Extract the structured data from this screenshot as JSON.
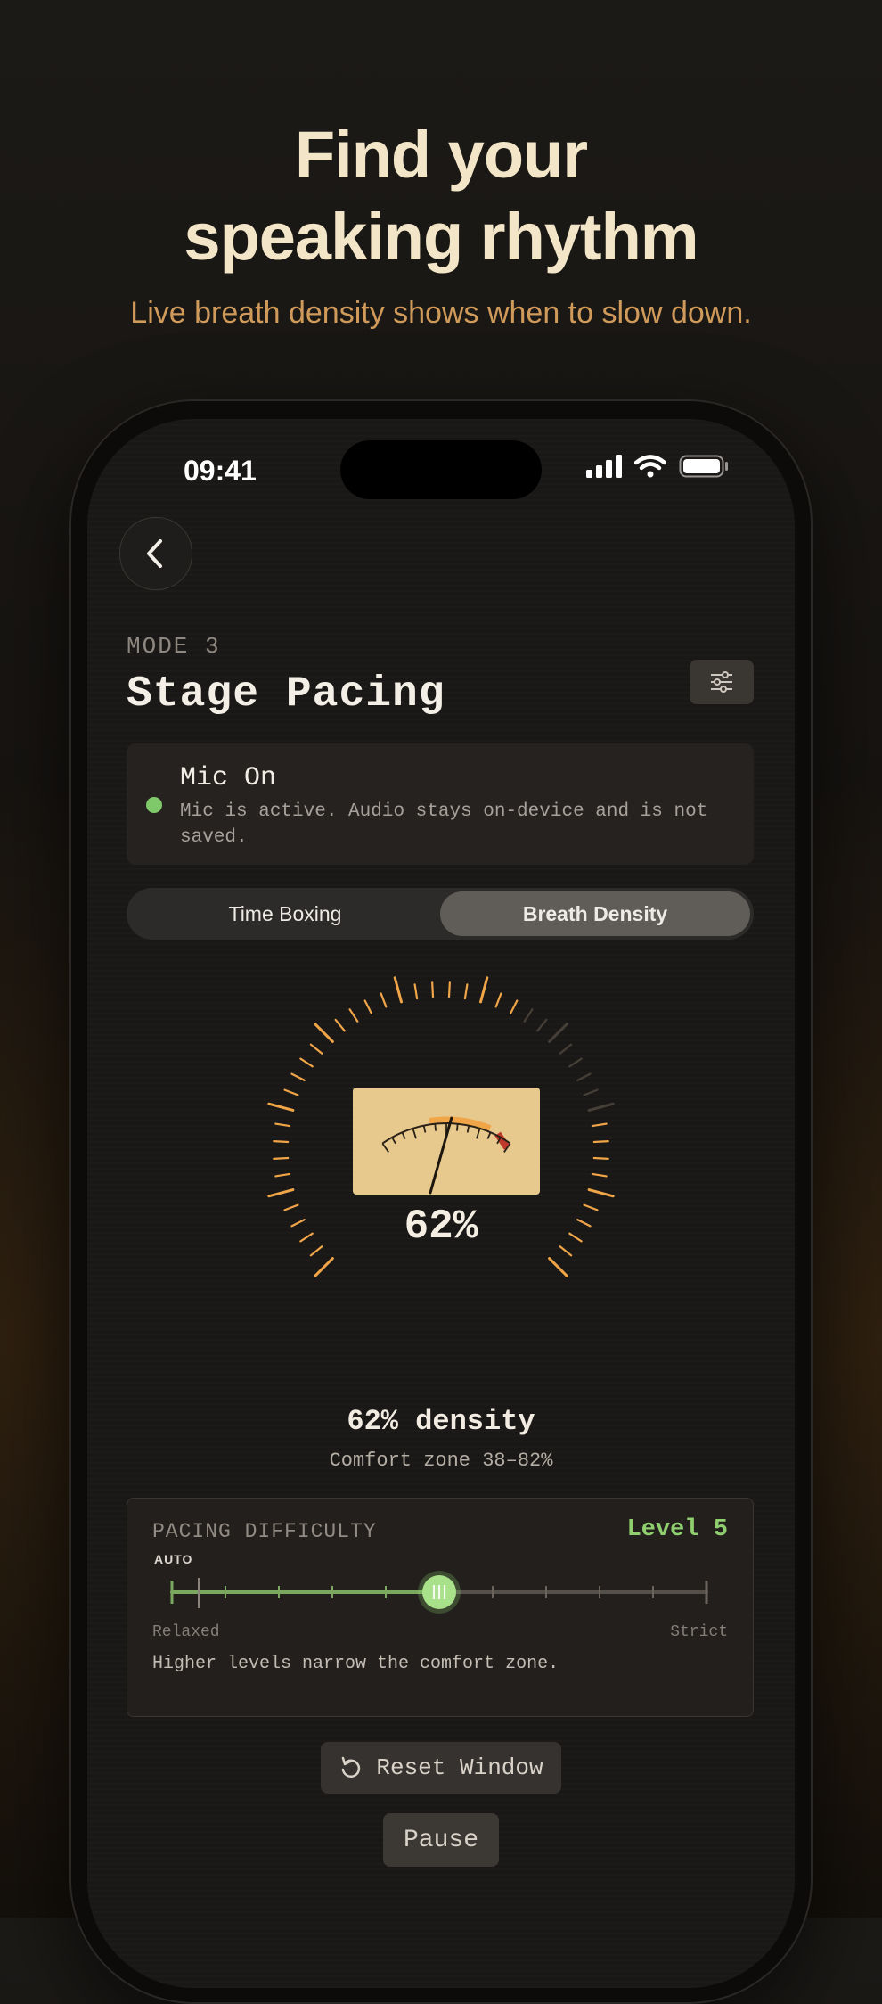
{
  "hero": {
    "title_line1": "Find your",
    "title_line2": "speaking rhythm",
    "subtitle": "Live breath density shows when to slow down."
  },
  "status_bar": {
    "time": "09:41",
    "icons": [
      "signal-icon",
      "wifi-icon",
      "battery-icon"
    ]
  },
  "header": {
    "back_icon": "chevron-left-icon",
    "mode_label": "MODE 3",
    "title": "Stage Pacing",
    "settings_icon": "sliders-icon"
  },
  "mic": {
    "title": "Mic On",
    "description": "Mic is active. Audio stays on-device and is not saved.",
    "status_color": "#7fc96a"
  },
  "tabs": [
    {
      "label": "Time Boxing",
      "active": false
    },
    {
      "label": "Breath Density",
      "active": true
    }
  ],
  "gauge": {
    "value_percent": 62,
    "readout": "62%",
    "comfort_min": 38,
    "comfort_max": 82
  },
  "density": {
    "label": "62% density",
    "comfort_text": "Comfort zone 38–82%"
  },
  "difficulty": {
    "title": "PACING DIFFICULTY",
    "level_text": "Level 5",
    "level": 5,
    "min_level": 0,
    "max_level": 10,
    "auto_level": 0.5,
    "auto_label": "AUTO",
    "min_label": "Relaxed",
    "max_label": "Strict",
    "note": "Higher levels narrow the comfort zone.",
    "accent_color": "#8fcf6f"
  },
  "actions": {
    "reset_label": "Reset Window",
    "reset_icon": "reset-arrow-icon",
    "pause_label": "Pause"
  },
  "colors": {
    "accent_orange": "#f0a548",
    "danger_red": "#c0392b",
    "meter_face": "#e7c98d"
  }
}
